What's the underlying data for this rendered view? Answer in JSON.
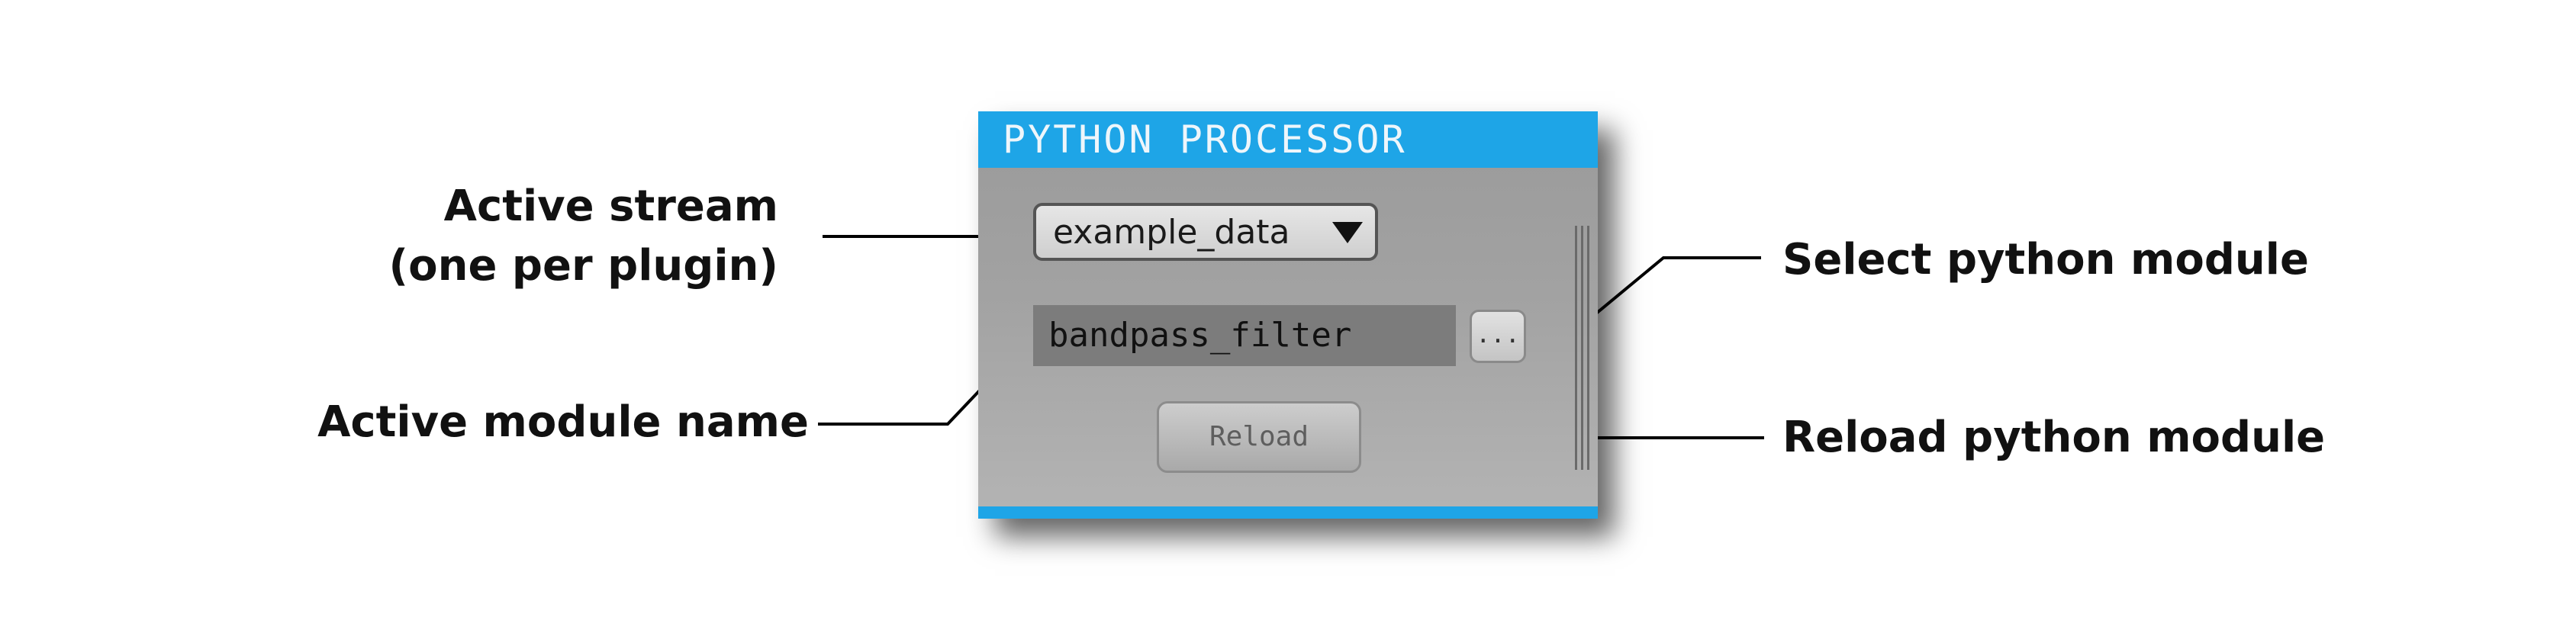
{
  "annotations": {
    "active_stream_line1": "Active stream",
    "active_stream_line2": "(one per plugin)",
    "active_module_name": "Active module name",
    "select_python_module": "Select python module",
    "reload_python_module": "Reload python module"
  },
  "panel": {
    "title": "PYTHON PROCESSOR",
    "stream_select": {
      "value": "example_data"
    },
    "module_name": {
      "value": "bandpass_filter"
    },
    "select_module_button": {
      "label": "..."
    },
    "reload_button": {
      "label": "Reload"
    }
  },
  "colors": {
    "header_accent": "#1ea5e7",
    "panel_background": "#a2a2a2",
    "module_field_background": "#7c7c7c"
  },
  "icons": {
    "dropdown": "triangle-down-icon"
  }
}
